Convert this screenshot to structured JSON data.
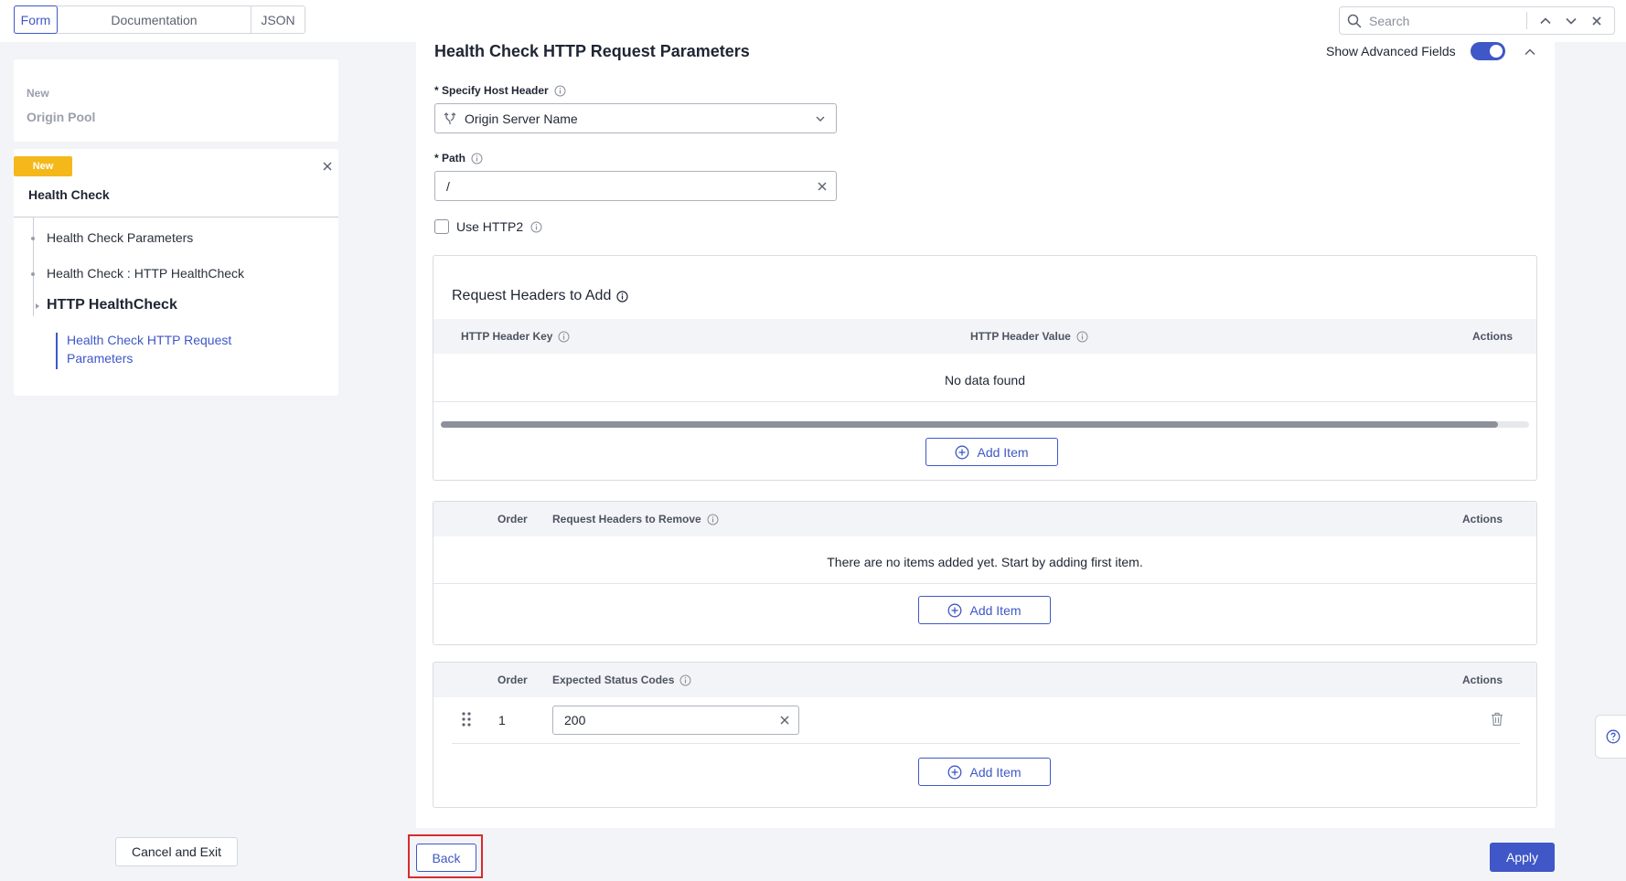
{
  "topbar": {
    "tabs": [
      {
        "label": "Form",
        "active": true
      },
      {
        "label": "Documentation",
        "active": false
      },
      {
        "label": "JSON",
        "active": false
      }
    ],
    "search": {
      "placeholder": "Search",
      "value": ""
    }
  },
  "sidebar": {
    "origin_card": {
      "badge": "New",
      "title": "Origin Pool"
    },
    "health_card": {
      "badge": "New",
      "title": "Health Check",
      "tree": [
        {
          "label": "Health Check Parameters"
        },
        {
          "label": "Health Check : HTTP HealthCheck"
        },
        {
          "label": "HTTP HealthCheck"
        },
        {
          "label": "Health Check HTTP Request Parameters"
        }
      ]
    },
    "cancel_label": "Cancel and Exit"
  },
  "main": {
    "section_title": "Health Check HTTP Request Parameters",
    "show_advanced_label": "Show Advanced Fields",
    "show_advanced_on": true,
    "host_header": {
      "label": "* Specify Host Header",
      "value": "Origin Server Name"
    },
    "path": {
      "label": "* Path",
      "value": "/"
    },
    "use_http2": {
      "label": "Use HTTP2",
      "checked": false
    },
    "headers_to_add": {
      "title": "Request Headers to Add",
      "columns": [
        "HTTP Header Key",
        "HTTP Header Value",
        "Actions"
      ],
      "empty": "No data found",
      "add_label": "Add Item"
    },
    "headers_to_remove": {
      "columns": [
        "Order",
        "Request Headers to Remove",
        "Actions"
      ],
      "empty": "There are no items added yet. Start by adding first item.",
      "add_label": "Add Item"
    },
    "status_codes": {
      "columns": [
        "Order",
        "Expected Status Codes",
        "Actions"
      ],
      "rows": [
        {
          "order": "1",
          "value": "200"
        }
      ],
      "add_label": "Add Item"
    }
  },
  "footer": {
    "back_label": "Back",
    "apply_label": "Apply"
  },
  "colors": {
    "accent": "#3f57c7",
    "badge": "#f4b81b",
    "highlight": "#d92b2b"
  }
}
